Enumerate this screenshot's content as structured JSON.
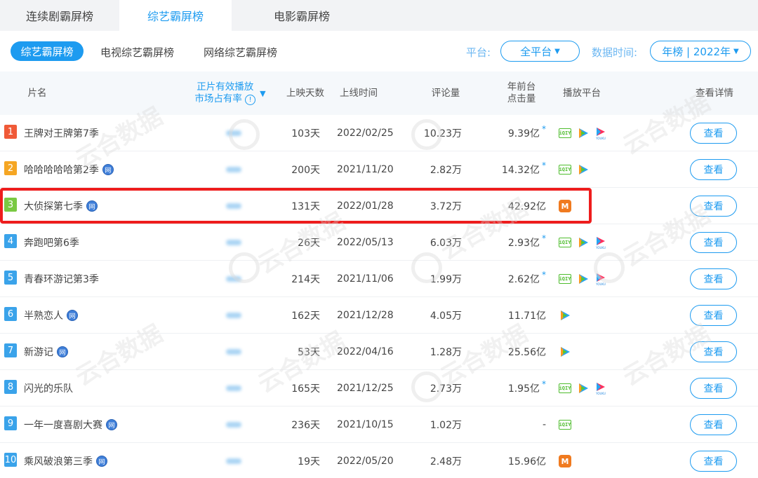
{
  "top_tabs": [
    "连续剧霸屏榜",
    "综艺霸屏榜",
    "电影霸屏榜"
  ],
  "sub_tabs": [
    "综艺霸屏榜",
    "电视综艺霸屏榜",
    "网络综艺霸屏榜"
  ],
  "filters": {
    "platform_label": "平台:",
    "platform_value": "全平台",
    "time_label": "数据时间:",
    "time_value": "年榜 | 2022年"
  },
  "headers": {
    "title": "片名",
    "share_line1": "正片有效播放",
    "share_line2": "市场占有率",
    "share_info": "!",
    "days": "上映天数",
    "date": "上线时间",
    "comments": "评论量",
    "clicks_line1": "年前台",
    "clicks_line2": "点击量",
    "platforms": "播放平台",
    "details": "查看详情"
  },
  "rank_colors": [
    "#f05a38",
    "#f5a623",
    "#7ac943",
    "#3aa3ea",
    "#3aa3ea",
    "#3aa3ea",
    "#3aa3ea",
    "#3aa3ea",
    "#3aa3ea",
    "#3aa3ea"
  ],
  "view_label": "查看",
  "wang_label": "网",
  "watermark": "云合数据",
  "rows": [
    {
      "rank": "1",
      "title": "王牌对王牌第7季",
      "wang": false,
      "days": "103天",
      "date": "2022/02/25",
      "comments": "10.23万",
      "clicks": "9.39亿",
      "star": true,
      "platforms": [
        "iqiyi",
        "tencent",
        "youku"
      ]
    },
    {
      "rank": "2",
      "title": "哈哈哈哈哈第2季",
      "wang": true,
      "days": "200天",
      "date": "2021/11/20",
      "comments": "2.82万",
      "clicks": "14.32亿",
      "star": true,
      "platforms": [
        "iqiyi",
        "tencent"
      ]
    },
    {
      "rank": "3",
      "title": "大侦探第七季",
      "wang": true,
      "days": "131天",
      "date": "2022/01/28",
      "comments": "3.72万",
      "clicks": "42.92亿",
      "star": false,
      "platforms": [
        "mango"
      ]
    },
    {
      "rank": "4",
      "title": "奔跑吧第6季",
      "wang": false,
      "days": "26天",
      "date": "2022/05/13",
      "comments": "6.03万",
      "clicks": "2.93亿",
      "star": true,
      "platforms": [
        "iqiyi",
        "tencent",
        "youku"
      ]
    },
    {
      "rank": "5",
      "title": "青春环游记第3季",
      "wang": false,
      "days": "214天",
      "date": "2021/11/06",
      "comments": "1.99万",
      "clicks": "2.62亿",
      "star": true,
      "platforms": [
        "iqiyi",
        "tencent",
        "youku"
      ]
    },
    {
      "rank": "6",
      "title": "半熟恋人",
      "wang": true,
      "days": "162天",
      "date": "2021/12/28",
      "comments": "4.05万",
      "clicks": "11.71亿",
      "star": false,
      "platforms": [
        "tencent"
      ]
    },
    {
      "rank": "7",
      "title": "新游记",
      "wang": true,
      "days": "53天",
      "date": "2022/04/16",
      "comments": "1.28万",
      "clicks": "25.56亿",
      "star": false,
      "platforms": [
        "tencent"
      ]
    },
    {
      "rank": "8",
      "title": "闪光的乐队",
      "wang": false,
      "days": "165天",
      "date": "2021/12/25",
      "comments": "2.73万",
      "clicks": "1.95亿",
      "star": true,
      "platforms": [
        "iqiyi",
        "tencent",
        "youku"
      ]
    },
    {
      "rank": "9",
      "title": "一年一度喜剧大赛",
      "wang": true,
      "days": "236天",
      "date": "2021/10/15",
      "comments": "1.02万",
      "clicks": "-",
      "star": false,
      "platforms": [
        "iqiyi"
      ]
    },
    {
      "rank": "10",
      "title": "乘风破浪第三季",
      "wang": true,
      "days": "19天",
      "date": "2022/05/20",
      "comments": "2.48万",
      "clicks": "15.96亿",
      "star": false,
      "platforms": [
        "mango"
      ]
    }
  ]
}
